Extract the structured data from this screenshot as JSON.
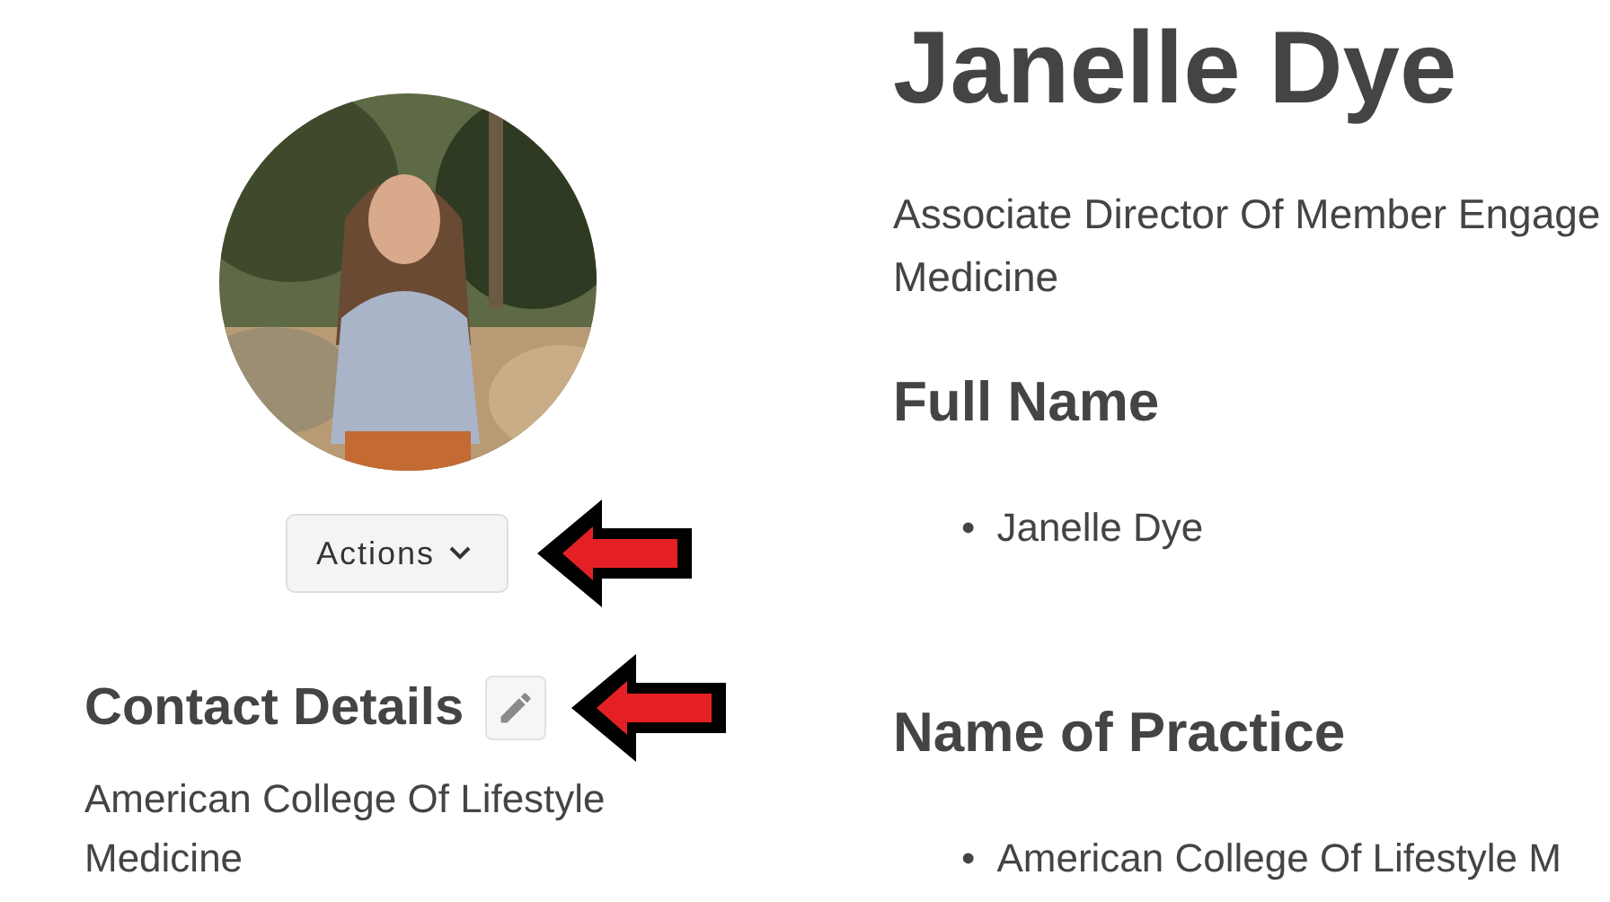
{
  "profile": {
    "actions_button": {
      "label": "Actions"
    },
    "contact": {
      "heading": "Contact Details",
      "address_lines": [
        "American College Of Lifestyle",
        "Medicine"
      ]
    }
  },
  "main": {
    "name": "Janelle Dye",
    "subtitle_lines": [
      "Associate Director Of Member Engage",
      "Medicine"
    ],
    "sections": [
      {
        "heading": "Full Name",
        "items": [
          {
            "marker": "•",
            "text": "Janelle Dye"
          }
        ]
      },
      {
        "heading": "Name of Practice",
        "items": [
          {
            "marker": "•",
            "text": "American College Of Lifestyle M"
          }
        ]
      }
    ]
  }
}
